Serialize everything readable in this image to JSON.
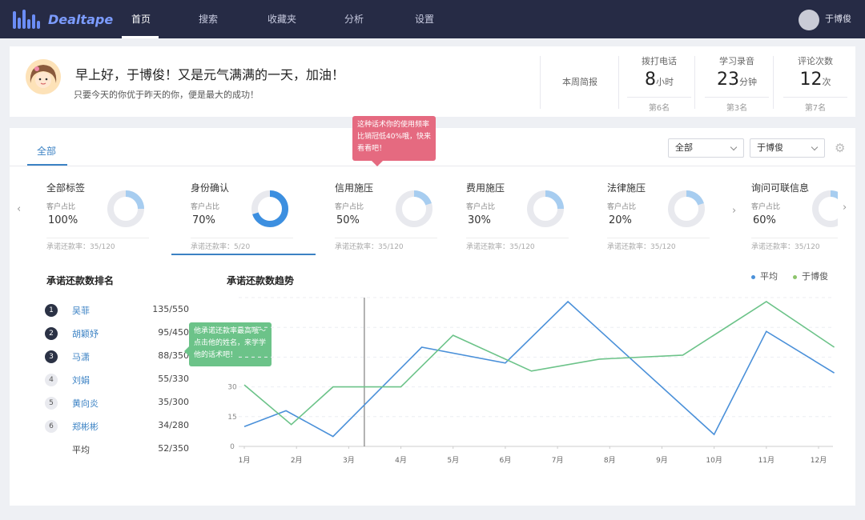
{
  "app": {
    "name": "Dealtape"
  },
  "nav": {
    "items": [
      {
        "label": "首页",
        "active": true
      },
      {
        "label": "搜索"
      },
      {
        "label": "收藏夹"
      },
      {
        "label": "分析"
      },
      {
        "label": "设置"
      }
    ],
    "user_name": "于博俊"
  },
  "greeting": {
    "title": "早上好，于博俊！又是元气满满的一天，加油！",
    "subtitle": "只要今天的你优于昨天的你，便是最大的成功！",
    "weekly_label": "本周简报",
    "stats": [
      {
        "label": "拨打电话",
        "value": "8",
        "unit": "小时",
        "rank": "第6名"
      },
      {
        "label": "学习录音",
        "value": "23",
        "unit": "分钟",
        "rank": "第3名"
      },
      {
        "label": "评论次数",
        "value": "12",
        "unit": "次",
        "rank": "第7名"
      }
    ]
  },
  "tabs": {
    "all_label": "全部"
  },
  "filters": {
    "scope_selected": "全部",
    "person_selected": "于博俊"
  },
  "tooltip_red": "这种话术你的使用频率比销冠低40%哦，快来看看吧！",
  "categories": [
    {
      "name": "全部标签",
      "sub": "客户占比",
      "pct": "100%",
      "ratio": 0.25,
      "footer": "承诺还款率：35/120"
    },
    {
      "name": "身份确认",
      "sub": "客户占比",
      "pct": "70%",
      "ratio": 0.7,
      "footer": "承诺还款率：5/20",
      "active": true
    },
    {
      "name": "信用施压",
      "sub": "客户占比",
      "pct": "50%",
      "ratio": 0.2,
      "footer": "承诺还款率：35/120"
    },
    {
      "name": "费用施压",
      "sub": "客户占比",
      "pct": "30%",
      "ratio": 0.25,
      "footer": "承诺还款率：35/120"
    },
    {
      "name": "法律施压",
      "sub": "客户占比",
      "pct": "20%",
      "ratio": 0.2,
      "footer": "承诺还款率：35/120"
    },
    {
      "name": "询问可联信息",
      "sub": "客户占比",
      "pct": "60%",
      "ratio": 0.25,
      "footer": "承诺还款率：35/120"
    }
  ],
  "ranking": {
    "title": "承诺还款数排名",
    "rows": [
      {
        "rank": "1",
        "name": "吴菲",
        "score": "135/550"
      },
      {
        "rank": "2",
        "name": "胡颖妤",
        "score": "95/450"
      },
      {
        "rank": "3",
        "name": "马潇",
        "score": "88/350"
      },
      {
        "rank": "4",
        "name": "刘娟",
        "score": "55/330"
      },
      {
        "rank": "5",
        "name": "黄向炎",
        "score": "35/300"
      },
      {
        "rank": "6",
        "name": "郑彬彬",
        "score": "34/280"
      }
    ],
    "average": {
      "name": "平均",
      "score": "52/350"
    }
  },
  "tooltip_green": "他承诺还款率最高哦～点击他的姓名，来学学他的话术吧！",
  "chart_data": {
    "type": "line",
    "title": "承诺还款数趋势",
    "categories": [
      "1月",
      "2月",
      "3月",
      "4月",
      "5月",
      "6月",
      "7月",
      "8月",
      "9月",
      "10月",
      "11月",
      "12月"
    ],
    "x": [
      1,
      2,
      3,
      4,
      5,
      6,
      7,
      8,
      9,
      10,
      11,
      12
    ],
    "yticks": [
      0,
      15,
      30
    ],
    "ylim": [
      0,
      75
    ],
    "series": [
      {
        "name": "平均",
        "color": "#4a90d9",
        "points": [
          [
            1,
            10
          ],
          [
            1.8,
            18
          ],
          [
            2.7,
            5
          ],
          [
            4.4,
            50
          ],
          [
            6,
            42
          ],
          [
            7.2,
            73
          ],
          [
            10,
            6
          ],
          [
            11,
            58
          ],
          [
            12.3,
            37
          ]
        ]
      },
      {
        "name": "于博俊",
        "color": "#6cc389",
        "points": [
          [
            1,
            31
          ],
          [
            1.9,
            11
          ],
          [
            2.7,
            30
          ],
          [
            4,
            30
          ],
          [
            5,
            56
          ],
          [
            6.5,
            38
          ],
          [
            7.8,
            44
          ],
          [
            9.4,
            46
          ],
          [
            11,
            73
          ],
          [
            12.3,
            50
          ]
        ]
      }
    ],
    "cursor_x": 3.3,
    "grid": true,
    "legend_position": "top-right"
  }
}
